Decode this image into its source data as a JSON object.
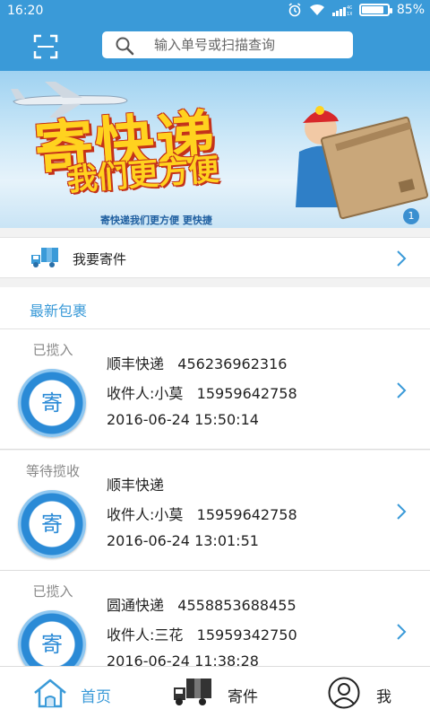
{
  "status_bar": {
    "time": "16:20",
    "battery_percent": "85%",
    "battery_level": 0.85,
    "network": "4G 1X"
  },
  "search": {
    "placeholder": "输入单号或扫描查询"
  },
  "banner": {
    "title": "寄快递",
    "subtitle": "我们更方便",
    "caption": "寄快递我们更方便 更快捷",
    "page_indicator": "1"
  },
  "send_row": {
    "label": "我要寄件"
  },
  "latest": {
    "title": "最新包裹"
  },
  "packages": [
    {
      "status": "已揽入",
      "badge": "寄",
      "courier": "顺丰快递",
      "tracking": "456236962316",
      "recipient": "收件人:小莫",
      "phone": "15959642758",
      "time": "2016-06-24 15:50:14"
    },
    {
      "status": "等待揽收",
      "badge": "寄",
      "courier": "顺丰快递",
      "tracking": "",
      "recipient": "收件人:小莫",
      "phone": "15959642758",
      "time": "2016-06-24 13:01:51"
    },
    {
      "status": "已揽入",
      "badge": "寄",
      "courier": "圆通快递",
      "tracking": "4558853688455",
      "recipient": "收件人:三花",
      "phone": "15959342750",
      "time": "2016-06-24 11:38:28"
    }
  ],
  "nav": [
    {
      "label": "首页",
      "icon": "home-icon",
      "active": true
    },
    {
      "label": "寄件",
      "icon": "truck-icon",
      "active": false
    },
    {
      "label": "我",
      "icon": "user-icon",
      "active": false
    }
  ],
  "colors": {
    "primary": "#3a9ad8",
    "accent_yellow": "#ffd21f",
    "accent_red": "#c4321a"
  }
}
